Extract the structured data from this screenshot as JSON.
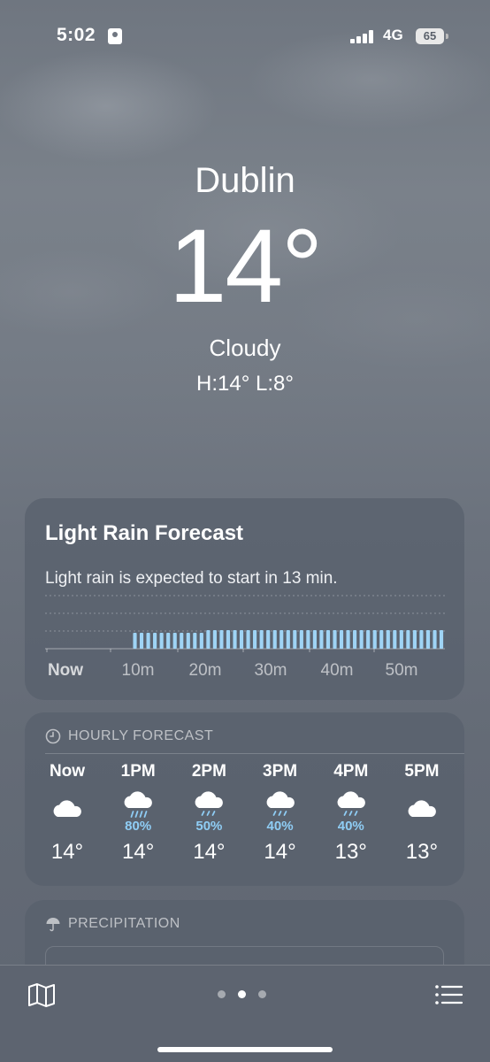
{
  "status_bar": {
    "time": "5:02",
    "network": "4G",
    "battery": "65",
    "icons": [
      "id-card-icon",
      "signal-bars-icon",
      "battery-icon"
    ]
  },
  "hero": {
    "city": "Dublin",
    "temperature": "14°",
    "condition": "Cloudy",
    "hi_lo": "H:14°  L:8°"
  },
  "rain_forecast": {
    "title": "Light Rain Forecast",
    "description": "Light rain is expected to start in 13 min.",
    "axis_labels": [
      "Now",
      "10m",
      "20m",
      "30m",
      "40m",
      "50m"
    ],
    "bar_color": "#9fd4f5",
    "minute_intensity": [
      0,
      0,
      0,
      0,
      0,
      0,
      0,
      0,
      0,
      0,
      0,
      0,
      0,
      0.3,
      0.3,
      0.3,
      0.3,
      0.3,
      0.3,
      0.3,
      0.3,
      0.3,
      0.3,
      0.3,
      0.35,
      0.35,
      0.35,
      0.35,
      0.35,
      0.35,
      0.35,
      0.35,
      0.35,
      0.35,
      0.35,
      0.35,
      0.35,
      0.35,
      0.35,
      0.35,
      0.35,
      0.35,
      0.35,
      0.35,
      0.35,
      0.35,
      0.35,
      0.35,
      0.35,
      0.35,
      0.35,
      0.35,
      0.35,
      0.35,
      0.35,
      0.35,
      0.35,
      0.35,
      0.35,
      0.35
    ]
  },
  "hourly_forecast": {
    "heading": "HOURLY FORECAST",
    "hours": [
      {
        "label": "Now",
        "icon": "cloud-icon",
        "precip": "",
        "temp": "14°"
      },
      {
        "label": "1PM",
        "icon": "cloud-rain-icon",
        "precip": "80%",
        "temp": "14°"
      },
      {
        "label": "2PM",
        "icon": "cloud-drizzle-icon",
        "precip": "50%",
        "temp": "14°"
      },
      {
        "label": "3PM",
        "icon": "cloud-drizzle-icon",
        "precip": "40%",
        "temp": "14°"
      },
      {
        "label": "4PM",
        "icon": "cloud-drizzle-icon",
        "precip": "40%",
        "temp": "13°"
      },
      {
        "label": "5PM",
        "icon": "cloud-icon",
        "precip": "",
        "temp": "13°"
      }
    ]
  },
  "precipitation": {
    "heading": "PRECIPITATION"
  },
  "toolbar": {
    "page_count": 3,
    "active_page": 2,
    "icons": [
      "map-icon",
      "list-icon"
    ]
  }
}
